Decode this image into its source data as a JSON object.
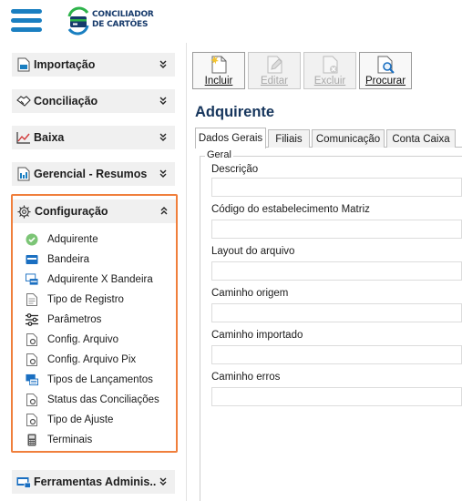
{
  "app": {
    "logo_line1": "CONCILIADOR",
    "logo_line2": "DE CARTÕES"
  },
  "colors": {
    "accent": "#1a7fc1",
    "highlight_border": "#f07f3c",
    "title": "#16355c"
  },
  "sidebar": {
    "menus": [
      {
        "label": "Importação",
        "icon": "import-document-icon",
        "expanded": false
      },
      {
        "label": "Conciliação",
        "icon": "handshake-icon",
        "expanded": false
      },
      {
        "label": "Baixa",
        "icon": "chart-line-icon",
        "expanded": false
      },
      {
        "label": "Gerencial - Resumos",
        "icon": "report-icon",
        "expanded": false
      },
      {
        "label": "Configuração",
        "icon": "gear-icon",
        "expanded": true
      },
      {
        "label": "Ferramentas Adminis...",
        "icon": "tools-icon",
        "expanded": false
      }
    ],
    "config_items": [
      {
        "label": "Adquirente",
        "icon": "check-circle-icon"
      },
      {
        "label": "Bandeira",
        "icon": "card-brand-icon"
      },
      {
        "label": "Adquirente X Bandeira",
        "icon": "monitor-card-icon"
      },
      {
        "label": "Tipo de Registro",
        "icon": "document-icon"
      },
      {
        "label": "Parâmetros",
        "icon": "sliders-icon"
      },
      {
        "label": "Config. Arquivo",
        "icon": "file-gear-icon"
      },
      {
        "label": "Config. Arquivo Pix",
        "icon": "file-gear-icon"
      },
      {
        "label": "Tipos de Lançamentos",
        "icon": "monitor-list-icon"
      },
      {
        "label": "Status das Conciliações",
        "icon": "file-gear-icon"
      },
      {
        "label": "Tipo de Ajuste",
        "icon": "file-gear-icon"
      },
      {
        "label": "Terminais",
        "icon": "pos-terminal-icon"
      }
    ]
  },
  "toolbar": {
    "incluir": "Incluir",
    "editar": "Editar",
    "excluir": "Excluir",
    "procurar": "Procurar"
  },
  "page": {
    "title": "Adquirente",
    "tabs": [
      "Dados Gerais",
      "Filiais",
      "Comunicação",
      "Conta Caixa"
    ],
    "active_tab": "Dados Gerais",
    "group_legend": "Geral",
    "fields": [
      {
        "label": "Descrição",
        "value": ""
      },
      {
        "label": "Código do estabelecimento Matriz",
        "value": ""
      },
      {
        "label": "Layout do arquivo",
        "value": ""
      },
      {
        "label": "Caminho origem",
        "value": ""
      },
      {
        "label": "Caminho importado",
        "value": ""
      },
      {
        "label": "Caminho erros",
        "value": ""
      }
    ]
  }
}
